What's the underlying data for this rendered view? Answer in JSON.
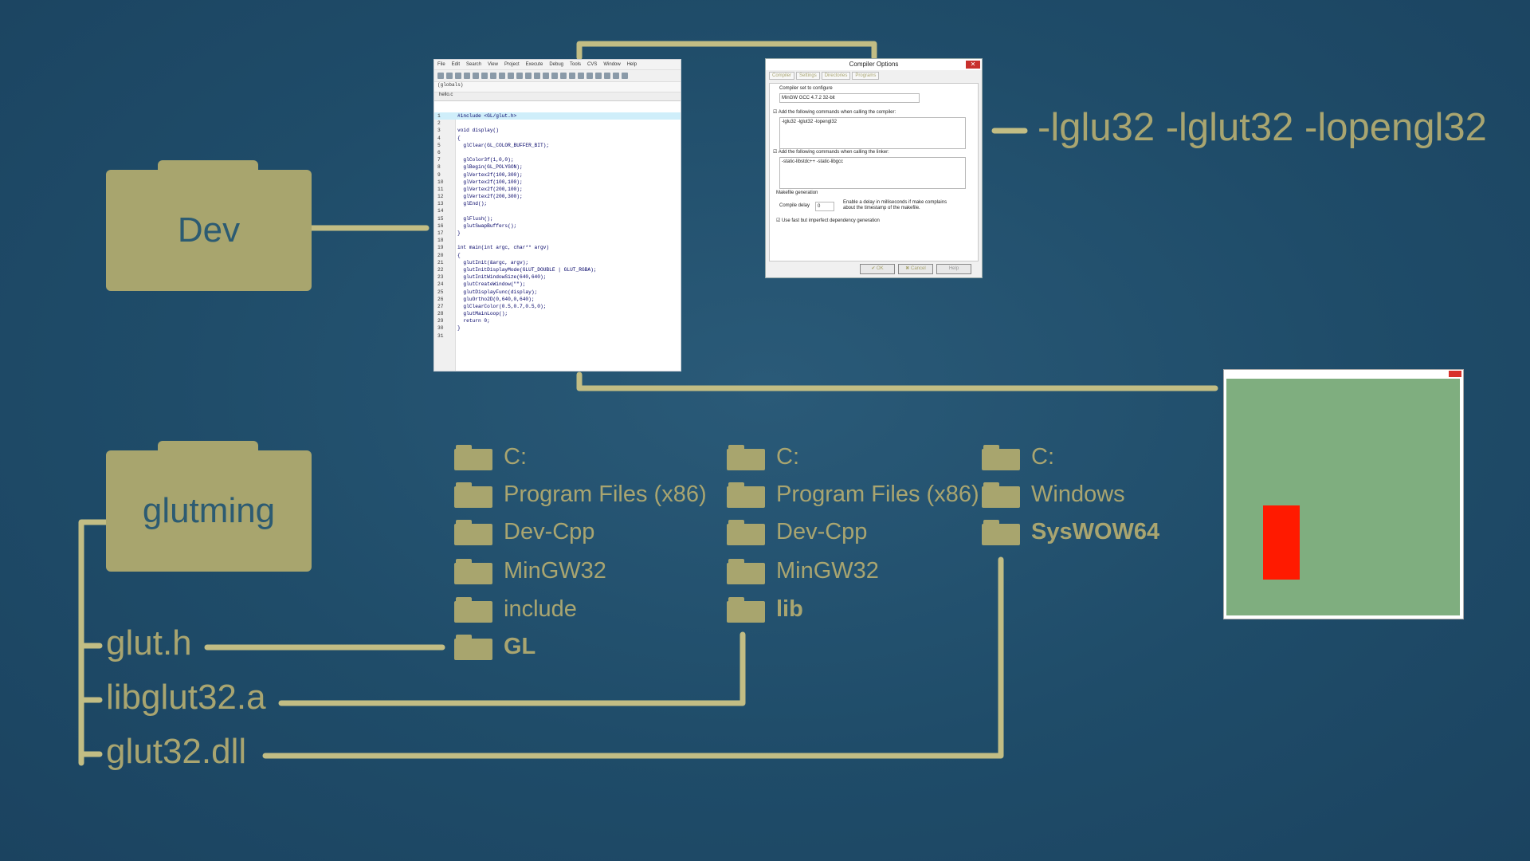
{
  "folders": {
    "dev": "Dev",
    "glutming": "glutming"
  },
  "linker_flags": "-lglu32 -lglut32 -lopengl32",
  "files": {
    "header": "glut.h",
    "static_lib": "libglut32.a",
    "dll": "glut32.dll"
  },
  "path_include": [
    "C:",
    "Program Files (x86)",
    "Dev-Cpp",
    "MinGW32",
    "include",
    "GL"
  ],
  "path_lib": [
    "C:",
    "Program Files (x86)",
    "Dev-Cpp",
    "MinGW32",
    "lib"
  ],
  "path_system": [
    "C:",
    "Windows",
    "SysWOW64"
  ],
  "ide": {
    "menu": [
      "File",
      "Edit",
      "Search",
      "View",
      "Project",
      "Execute",
      "Debug",
      "Tools",
      "CVS",
      "Window",
      "Help"
    ],
    "scope": "(globals)",
    "tab": "hello.c",
    "code": [
      "#include <GL/glut.h>",
      "",
      "void display()",
      "{",
      "  glClear(GL_COLOR_BUFFER_BIT);",
      "",
      "  glColor3f(1,0,0);",
      "  glBegin(GL_POLYGON);",
      "  glVertex2f(100,300);",
      "  glVertex2f(100,100);",
      "  glVertex2f(200,100);",
      "  glVertex2f(200,300);",
      "  glEnd();",
      "",
      "  glFlush();",
      "  glutSwapBuffers();",
      "}",
      "",
      "int main(int argc, char** argv)",
      "{",
      "  glutInit(&argc, argv);",
      "  glutInitDisplayMode(GLUT_DOUBLE | GLUT_RGBA);",
      "  glutInitWindowSize(640,640);",
      "  glutCreateWindow(\"\");",
      "  glutDisplayFunc(display);",
      "  gluOrtho2D(0,640,0,640);",
      "  glClearColor(0.5,0.7,0.5,0);",
      "  glutMainLoop();",
      "  return 0;",
      "}",
      ""
    ]
  },
  "dialog": {
    "title": "Compiler Options",
    "tabs": [
      "Compiler",
      "Settings",
      "Directories",
      "Programs"
    ],
    "set_label": "Compiler set to configure",
    "set_value": "MinGW GCC 4.7.2 32-bit",
    "compiler_cmd_label": "Add the following commands when calling the compiler:",
    "compiler_cmd": "-lglu32 -lglut32 -lopengl32",
    "linker_cmd_label": "Add the following commands when calling the linker:",
    "linker_cmd": "-static-libstdc++ -static-libgcc",
    "makefile_label": "Makefile generation",
    "compile_delay_label": "Compile delay",
    "compile_delay_value": "0",
    "delay_note": "Enable a delay in milliseconds if make complains about the timestamp of the makefile.",
    "fast_dep": "Use fast but imperfect dependency generation",
    "ok": "OK",
    "cancel": "Cancel",
    "help": "Help"
  },
  "colors": {
    "background": "#1f4c69",
    "accent": "#a8a56e",
    "folder_text": "#2c5b72",
    "gl_background": "#7fae7f",
    "gl_rect": "#ff1a00"
  }
}
